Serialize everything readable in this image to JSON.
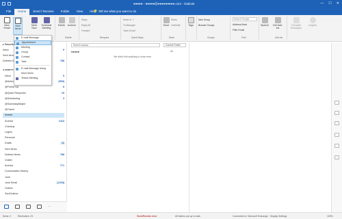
{
  "window": {
    "title": "●●●●● - ●●●●●@●●●●●●●●●.com - Outlook",
    "controls": [
      "—",
      "☐",
      "✕"
    ]
  },
  "menu": {
    "tabs": [
      "File",
      "Home",
      "Send / Receive",
      "Folder",
      "View",
      "Help"
    ],
    "tell_me": "Tell me what you want to do"
  },
  "ribbon": {
    "new_email": "New Email",
    "new_items": "New Items",
    "meet_now": "Meet Now",
    "schedule_meeting": "Schedule Meeting",
    "delete": "Delete",
    "archive": "Archive",
    "reply": "Reply",
    "reply_all": "Reply All",
    "forward": "Forward",
    "move_to": "Move to: ?",
    "to_manager": "To Manager",
    "team_email": "Team Email",
    "move": "Move",
    "rules": "Rules",
    "onenote": "OneNote",
    "tags": "Tags",
    "new_group": "New Group",
    "browse_groups": "Browse Groups",
    "search_people": "Search People",
    "address_book": "Address Book",
    "filter_email": "Filter Email",
    "speech": "Speech",
    "get_addins": "Get Add-ins",
    "translate_messages": "Translate Messages",
    "insights": "Insights",
    "groups": {
      "delete": "Delete",
      "respond": "Respond",
      "quick_steps": "Quick Steps",
      "move": "Move",
      "groups": "Groups",
      "find": "Find",
      "addins": "Add-ins"
    }
  },
  "new_items_menu": {
    "items": [
      "E-mail Message",
      "Appointment",
      "Meeting",
      "Group",
      "Contact",
      "Task"
    ],
    "items2": [
      "E-mail Message Using",
      "More Items",
      "Teams Meeting"
    ],
    "highlighted_index": 1
  },
  "folders": {
    "favorites_header": "Favorites",
    "favorites": [
      {
        "label": "Inbox",
        "count": "9"
      },
      {
        "label": "Sent Items",
        "count": ""
      },
      {
        "label": "Deleted Items",
        "count": "788"
      }
    ],
    "account": "sean●●●●●●●●●●●●●●",
    "tree": [
      {
        "label": "Inbox",
        "count": "9",
        "kind": "folder"
      },
      {
        "label": "@Action",
        "count": "(593)",
        "kind": "folder"
      },
      {
        "label": "@Follow Up",
        "count": "8",
        "kind": "folder"
      },
      {
        "label": "@Quick Response",
        "count": "19",
        "kind": "folder"
      },
      {
        "label": "@Scheduling",
        "count": "3",
        "kind": "folder"
      },
      {
        "label": "@SomedayMaybe",
        "count": "",
        "kind": "folder"
      },
      {
        "label": "@Travel",
        "count": "",
        "kind": "folder"
      },
      {
        "label": "●●●●●",
        "count": "",
        "kind": "selected"
      },
      {
        "label": "Archive",
        "count": "1413",
        "kind": "folder"
      },
      {
        "label": "Checkup",
        "count": "",
        "kind": "folder"
      },
      {
        "label": "Logins",
        "count": "",
        "kind": "folder"
      },
      {
        "label": "Personal",
        "count": "",
        "kind": "folder"
      },
      {
        "label": "Drafts",
        "count": "[3]",
        "kind": "folder"
      },
      {
        "label": "Sent Items",
        "count": "",
        "kind": "folder"
      },
      {
        "label": "Deleted Items",
        "count": "788",
        "kind": "folder"
      },
      {
        "label": "Clutter",
        "count": "",
        "kind": "folder"
      },
      {
        "label": "Archive",
        "count": "771",
        "kind": "folder"
      },
      {
        "label": "Conversation History",
        "count": "",
        "kind": "folder"
      },
      {
        "label": "Junk",
        "count": "",
        "kind": "folder"
      },
      {
        "label": "Junk Email",
        "count": "[1253]",
        "kind": "folder"
      },
      {
        "label": "Outbox",
        "count": "",
        "kind": "folder"
      },
      {
        "label": "SentOutbox",
        "count": "",
        "kind": "folder"
      }
    ]
  },
  "message_list": {
    "search_placeholder": "Search ●●●●●",
    "scope": "Current Folder",
    "folder_name": "●●●●●",
    "filter": "All",
    "empty_text": "We didn't find anything to show here."
  },
  "status": {
    "items": "Items: 0",
    "reminders": "Reminders: 23",
    "send_receive": "Send/Receive error",
    "folders_up_to_date": "All folders are up to date.",
    "connected": "Connected to: Microsoft Exchange",
    "display_settings": "Display Settings",
    "zoom": "100%"
  },
  "colors": {
    "accent": "#1e62b7",
    "highlight": "#cde6f7"
  }
}
